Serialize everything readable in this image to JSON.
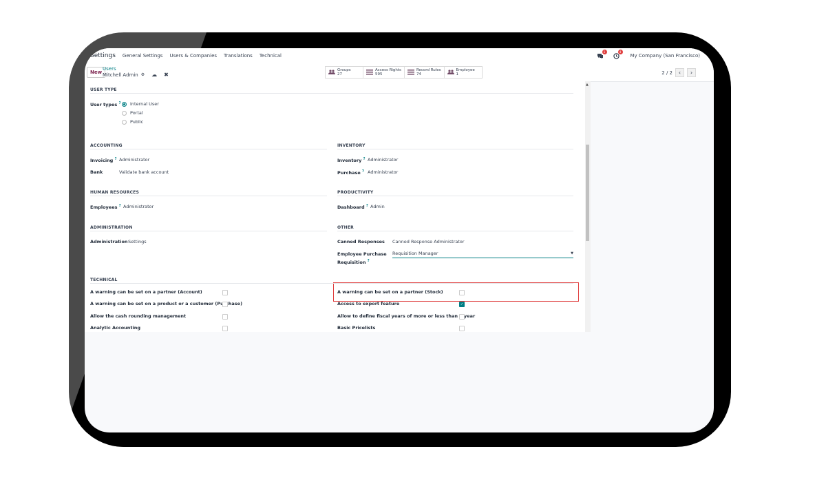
{
  "navbar": {
    "app_name": "Settings",
    "menu": [
      "General Settings",
      "Users & Companies",
      "Translations",
      "Technical"
    ],
    "chat_badge": "1",
    "activity_badge": "4",
    "company": "My Company (San Francisco)"
  },
  "control": {
    "new_label": "New",
    "breadcrumb_parent": "Users",
    "record_name": "Mitchell Admin",
    "smart_buttons": [
      {
        "label": "Groups",
        "count": "27",
        "icon": "users-icon"
      },
      {
        "label": "Access Rights",
        "count": "595",
        "icon": "list-icon"
      },
      {
        "label": "Record Rules",
        "count": "74",
        "icon": "list-icon"
      },
      {
        "label": "Employee",
        "count": "1",
        "icon": "users-icon"
      }
    ],
    "pager": "2 / 2"
  },
  "form": {
    "user_type": {
      "title": "USER TYPE",
      "label": "User types",
      "options": [
        "Internal User",
        "Portal",
        "Public"
      ],
      "selected": "Internal User"
    },
    "accounting": {
      "title": "ACCOUNTING",
      "fields": [
        {
          "label": "Invoicing",
          "value": "Administrator"
        },
        {
          "label": "Bank",
          "value": "Validate bank account"
        }
      ]
    },
    "inventory": {
      "title": "INVENTORY",
      "fields": [
        {
          "label": "Inventory",
          "value": "Administrator"
        },
        {
          "label": "Purchase",
          "value": "Administrator"
        }
      ]
    },
    "human_resources": {
      "title": "HUMAN RESOURCES",
      "fields": [
        {
          "label": "Employees",
          "value": "Administrator"
        }
      ]
    },
    "productivity": {
      "title": "PRODUCTIVITY",
      "fields": [
        {
          "label": "Dashboard",
          "value": "Admin"
        }
      ]
    },
    "administration": {
      "title": "ADMINISTRATION",
      "fields": [
        {
          "label": "Administration",
          "value": "Settings"
        }
      ]
    },
    "other": {
      "title": "OTHER",
      "fields": [
        {
          "label": "Canned Responses",
          "value": "Canned Response Administrator"
        },
        {
          "label_line1": "Employee Purchase",
          "label_line2": "Requisition",
          "value": "Requisition Manager"
        }
      ]
    },
    "technical": {
      "title": "TECHNICAL",
      "left": [
        {
          "label": "A warning can be set on a partner (Account)",
          "checked": false
        },
        {
          "label": "A warning can be set on a product or a customer (Purchase)",
          "checked": false
        },
        {
          "label": "Allow the cash rounding management",
          "checked": false
        },
        {
          "label": "Analytic Accounting",
          "checked": false
        }
      ],
      "right": [
        {
          "label": "A warning can be set on a partner (Stock)",
          "checked": false
        },
        {
          "label": "Access to export feature",
          "checked": true
        },
        {
          "label": "Allow to define fiscal years of more or less than a year",
          "checked": false
        },
        {
          "label": "Basic Pricelists",
          "checked": false
        }
      ]
    }
  },
  "colors": {
    "accent": "#017e84",
    "highlight": "#e03e3e",
    "brand": "#714b67"
  }
}
